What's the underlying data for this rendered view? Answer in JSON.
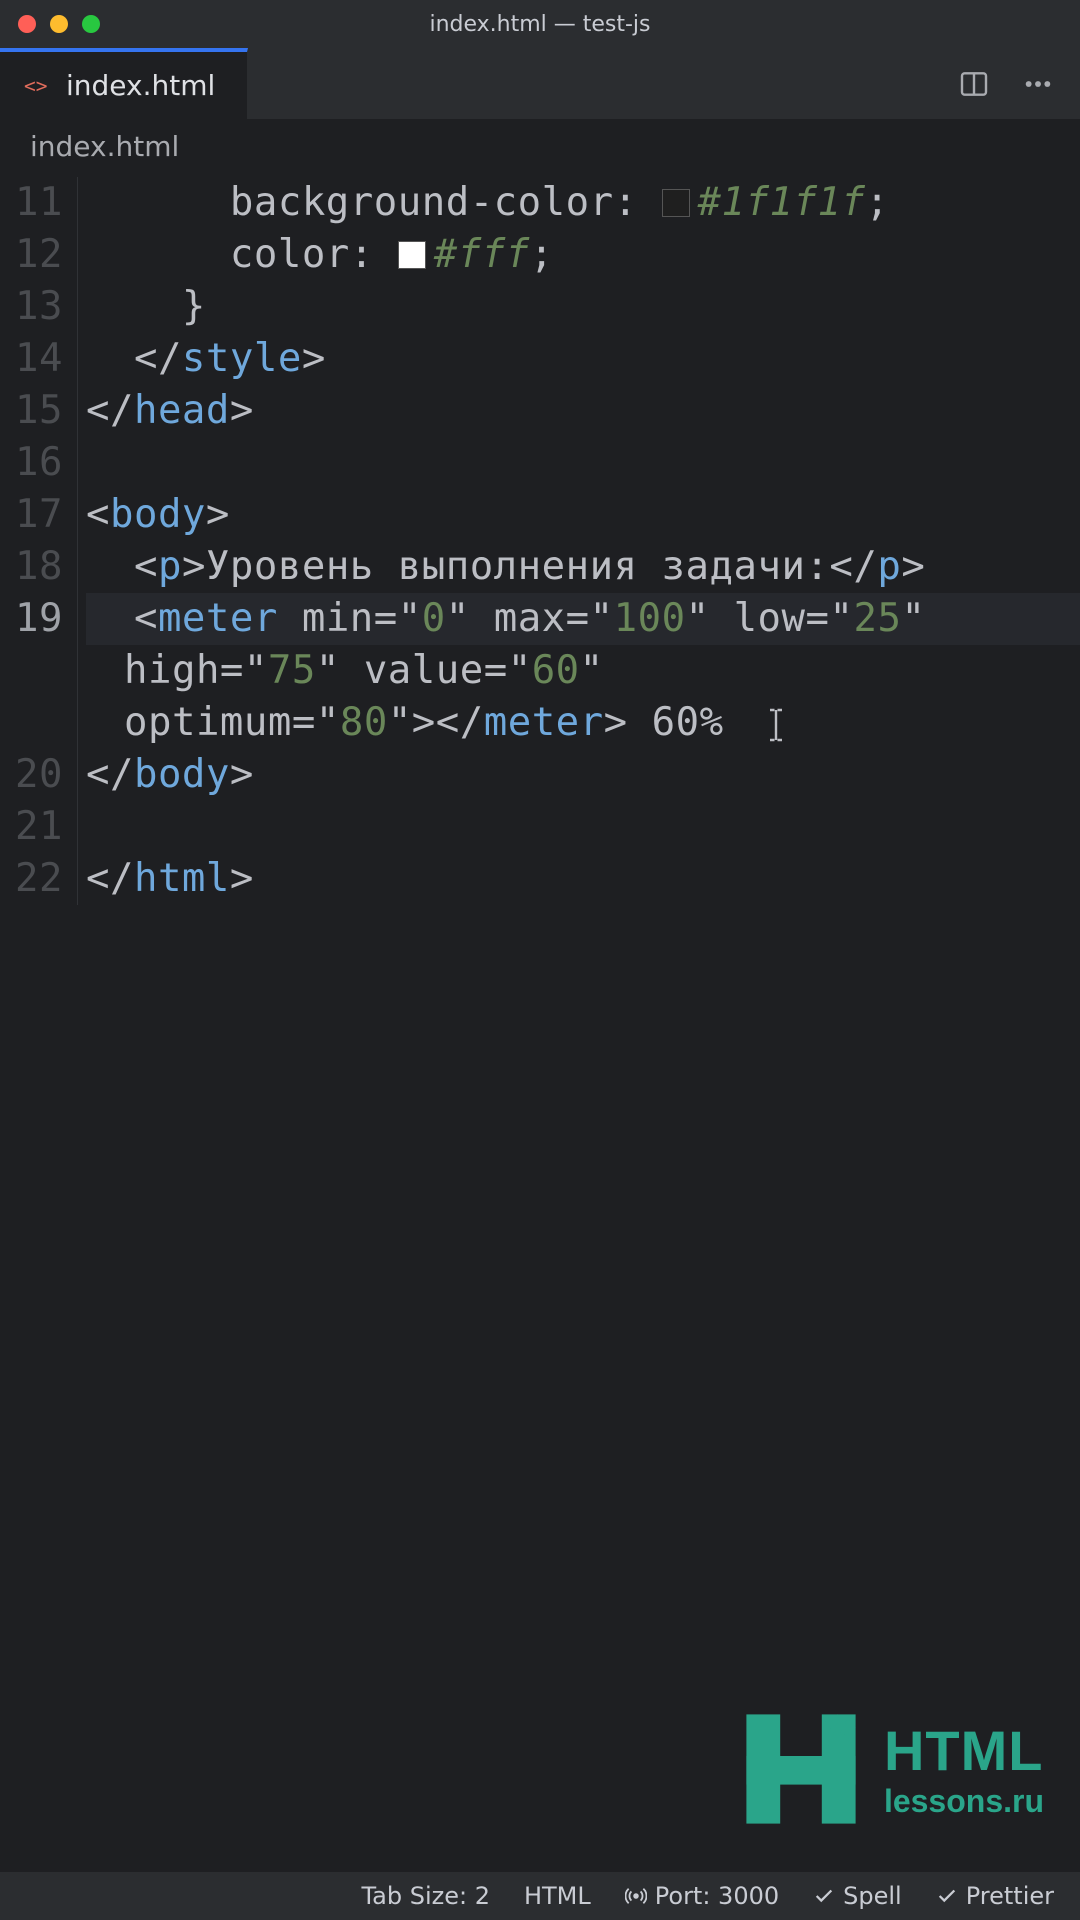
{
  "window": {
    "title": "index.html — test-js"
  },
  "traffic": {
    "close": "#ff5f57",
    "min": "#febc2e",
    "max": "#28c840"
  },
  "tab": {
    "label": "index.html"
  },
  "breadcrumb": "index.html",
  "lines": [
    "11",
    "12",
    "13",
    "14",
    "15",
    "16",
    "17",
    "18",
    "19",
    "20",
    "21",
    "22"
  ],
  "current_line_index": 8,
  "code": {
    "l11_prop": "background-color",
    "l11_sw": "#1f1f1f",
    "l11_hex": "#1f1f1f",
    "l12_prop": "color",
    "l12_sw": "#ffffff",
    "l12_hex": "#fff",
    "style_close": "style",
    "head_close": "head",
    "body_open": "body",
    "p_open": "p",
    "p_text": "Уровень выполнения задачи:",
    "p_close": "p",
    "meter": "meter",
    "attr_min": "min",
    "val_min": "0",
    "attr_max": "max",
    "val_max": "100",
    "attr_low": "low",
    "val_low": "25",
    "attr_high": "high",
    "val_high": "75",
    "attr_value": "value",
    "val_value": "60",
    "attr_optimum": "optimum",
    "val_optimum": "80",
    "after_meter": " 60%",
    "body_close": "body",
    "html_close": "html"
  },
  "logo": {
    "line1": "HTML",
    "line2": "lessons.ru"
  },
  "status": {
    "tabsize": "Tab Size: 2",
    "lang": "HTML",
    "port": "Port: 3000",
    "spell": "Spell",
    "prettier": "Prettier"
  }
}
